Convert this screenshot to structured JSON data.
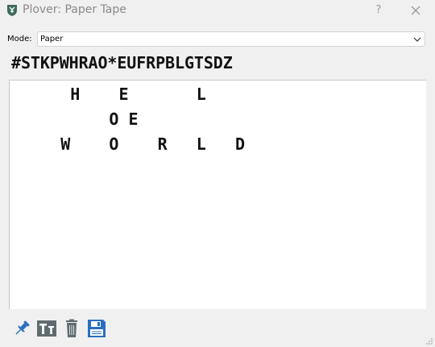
{
  "window": {
    "title": "Plover: Paper Tape",
    "help_glyph": "?"
  },
  "mode": {
    "label": "Mode:",
    "selected": "Paper"
  },
  "steno_header": "#STKPWHRAO*EUFRPBLGTSDZ",
  "tape": {
    "lines": [
      "      H    E       L",
      "          O E",
      "     W    O    R   L   D"
    ]
  },
  "toolbar": {
    "icons": [
      "pin-icon",
      "font-icon",
      "trash-icon",
      "save-icon"
    ]
  },
  "colors": {
    "accent_blue": "#2a6fbf",
    "icon_gray": "#5f6b70",
    "logo_green": "#3d6b5a"
  }
}
